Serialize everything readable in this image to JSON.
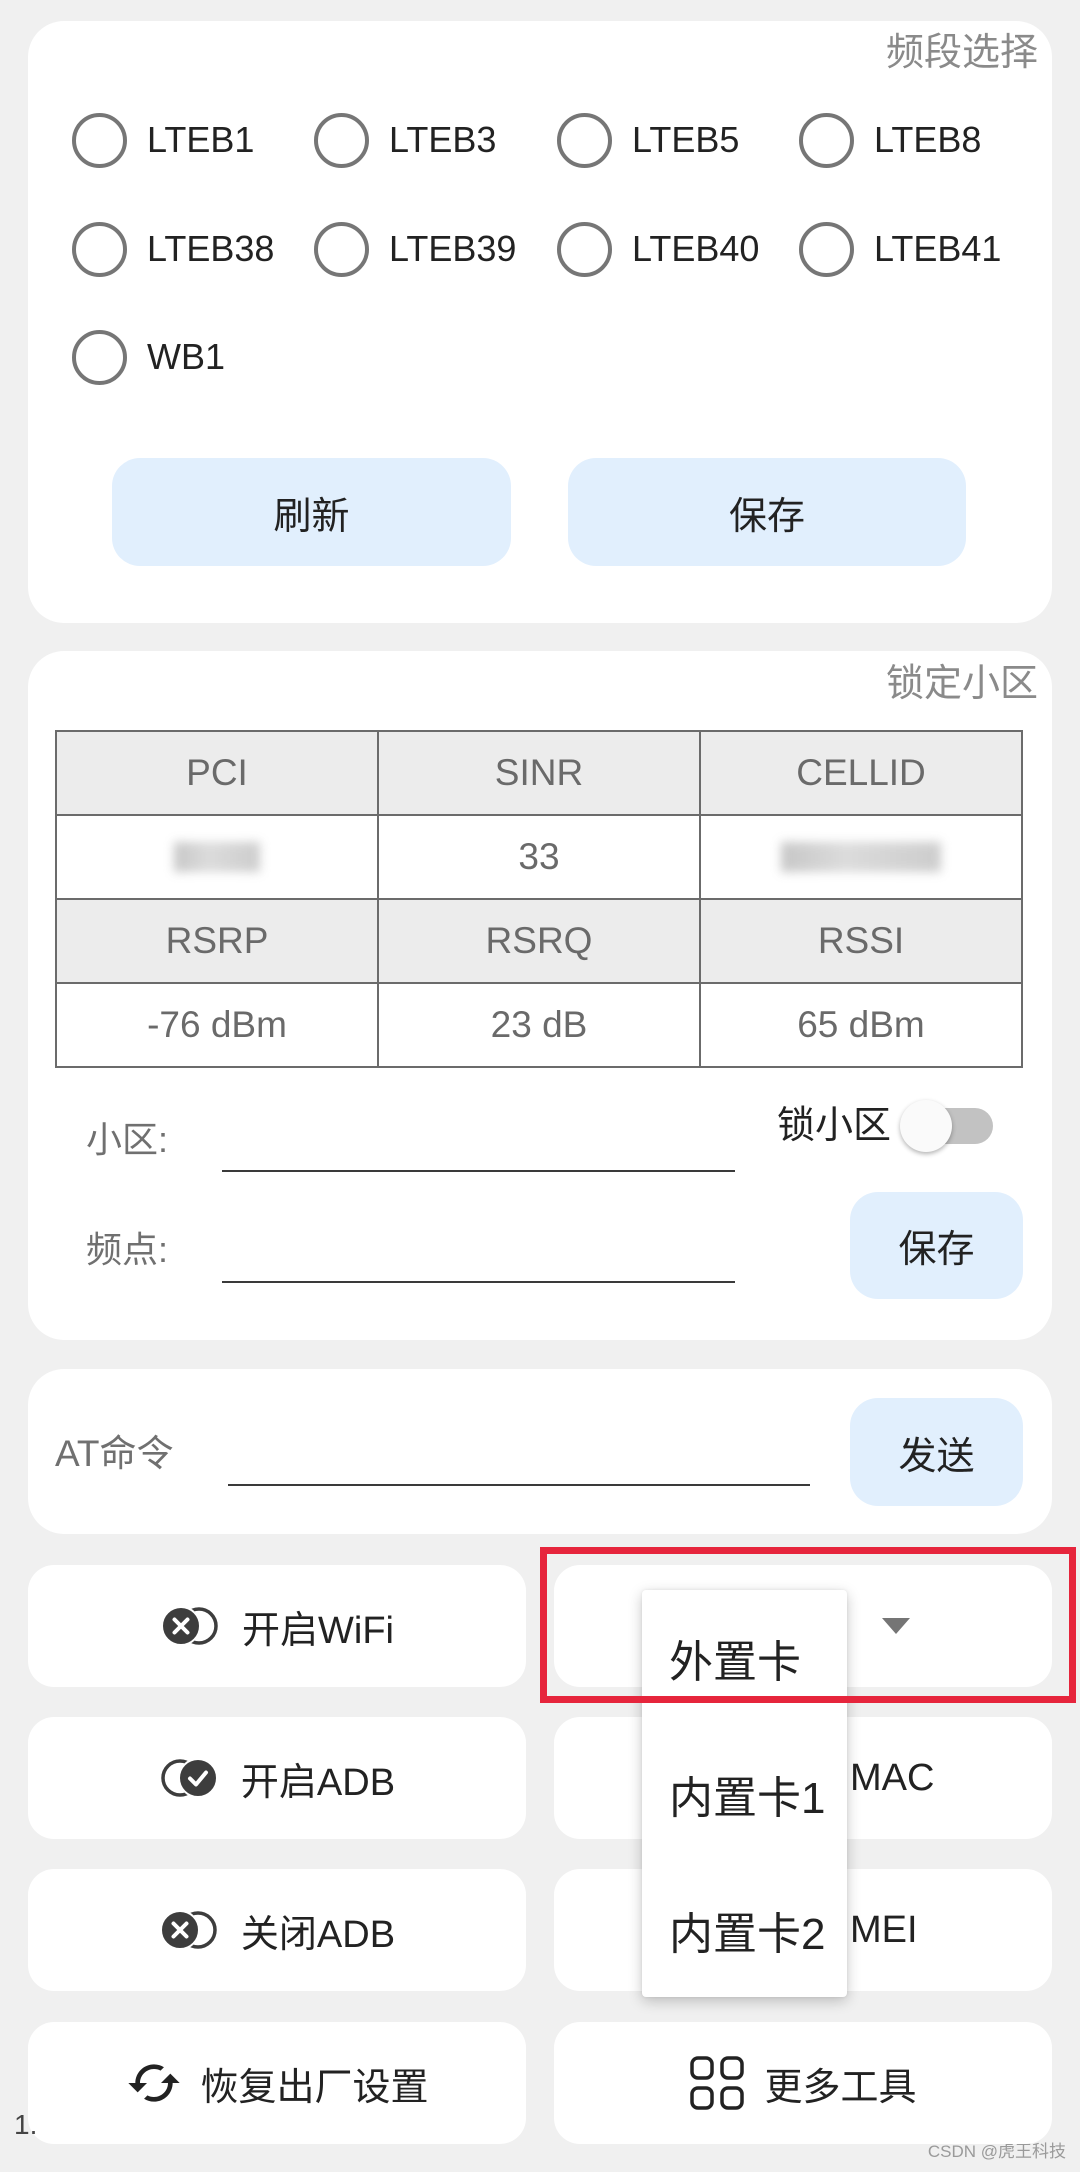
{
  "band_card": {
    "title": "频段选择",
    "bands": [
      {
        "label": "LTEB1",
        "checked": false
      },
      {
        "label": "LTEB3",
        "checked": false
      },
      {
        "label": "LTEB5",
        "checked": false
      },
      {
        "label": "LTEB8",
        "checked": false
      },
      {
        "label": "LTEB38",
        "checked": false
      },
      {
        "label": "LTEB39",
        "checked": false
      },
      {
        "label": "LTEB40",
        "checked": false
      },
      {
        "label": "LTEB41",
        "checked": false
      },
      {
        "label": "WB1",
        "checked": false
      }
    ],
    "refresh_label": "刷新",
    "save_label": "保存"
  },
  "lock_card": {
    "title": "锁定小区",
    "table": {
      "header_1": [
        "PCI",
        "SINR",
        "CELLID"
      ],
      "values_1": [
        null,
        "33",
        null
      ],
      "header_2": [
        "RSRP",
        "RSRQ",
        "RSSI"
      ],
      "values_2": [
        "-76 dBm",
        "23 dB",
        "65 dBm"
      ]
    },
    "lock_label": "锁小区",
    "lock_on": false,
    "cell_label": "小区:",
    "cell_value": "",
    "freq_label": "频点:",
    "freq_value": "",
    "save_label": "保存"
  },
  "at_card": {
    "label": "AT命令",
    "value": "",
    "send_label": "发送"
  },
  "actions": {
    "wifi_on_label": "开启WiFi",
    "adb_on_label": "开启ADB",
    "adb_off_label": "关闭ADB",
    "factory_reset_label": "恢复出厂设置",
    "more_tools_label": "更多工具",
    "row2_right_label": "MAC",
    "row3_right_label": "MEI",
    "icons": {
      "wifi_on": "toggle-x-icon",
      "adb_on": "toggle-check-icon",
      "adb_off": "toggle-x-icon",
      "factory_reset": "refresh-icon",
      "more_tools": "grid-icon",
      "spinner": "dropdown-arrow-icon"
    }
  },
  "sim_spinner": {
    "expanded": true,
    "options": [
      "外置卡",
      "内置卡1",
      "内置卡2"
    ]
  },
  "footer": {
    "version_fragment": "1.",
    "watermark": "CSDN @虎王科技"
  },
  "colors": {
    "page_bg": "#f0f0f0",
    "card_bg": "#ffffff",
    "button_bg": "#e1effd",
    "highlight_border": "#e6253c"
  }
}
